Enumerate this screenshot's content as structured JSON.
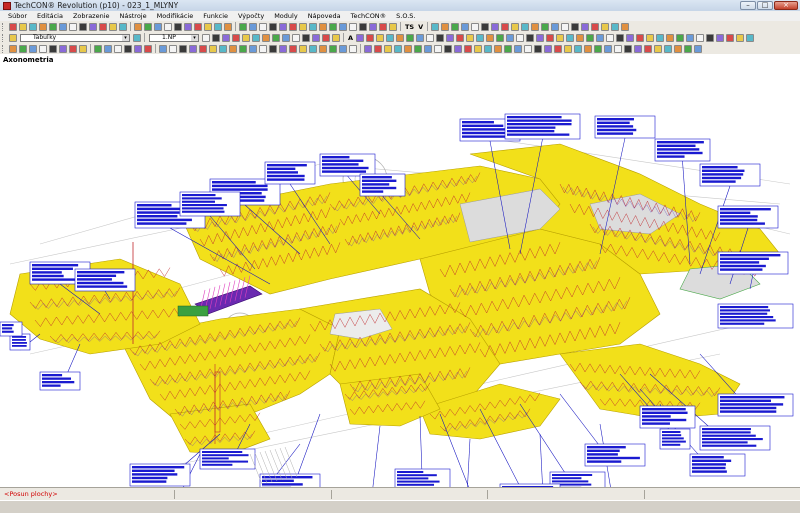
{
  "window": {
    "title": "TechCON® Revolution  (p10) - 023_1_MLYNY",
    "controls": [
      "minimize",
      "maximize",
      "close"
    ]
  },
  "menu": {
    "items": [
      "Súbor",
      "Editácia",
      "Zobrazenie",
      "Nástroje",
      "Modifikácie",
      "Funkcie",
      "Výpočty",
      "Moduly",
      "Nápoveda",
      "TechCON®",
      "S.O.S."
    ]
  },
  "toolbars": {
    "layer_combo": "Tabuľky",
    "floor_combo": "1.NP",
    "ts_label": "TS",
    "v_label": "V",
    "a_label": "A"
  },
  "view": {
    "label": "Axonometria"
  },
  "status": {
    "message": "<Posun plochy>"
  },
  "colors": {
    "floor_fill": "#f2e01a",
    "heating_loop": "#c0282d",
    "leader_line": "#1010c0",
    "note_box": "#1a1ad0",
    "wall_line": "#8a8a8a"
  }
}
